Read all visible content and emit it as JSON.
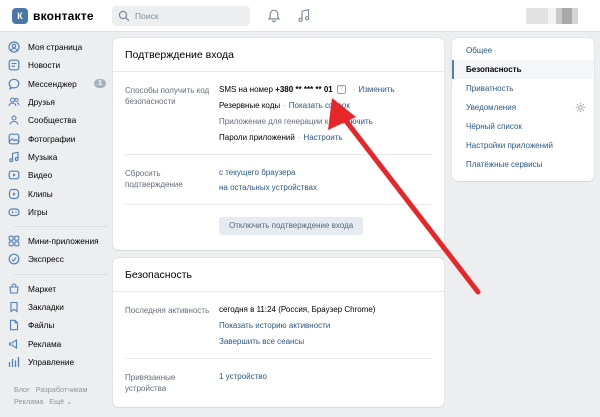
{
  "header": {
    "logo_text": "вконтакте",
    "logo_mark": "К",
    "search_placeholder": "Поиск",
    "bell_icon": "bell-icon",
    "music_icon": "music-icon"
  },
  "sidebar": {
    "items": [
      {
        "label": "Моя страница",
        "icon": "home-icon"
      },
      {
        "label": "Новости",
        "icon": "news-icon"
      },
      {
        "label": "Мессенджер",
        "icon": "message-icon",
        "badge": "1"
      },
      {
        "label": "Друзья",
        "icon": "friends-icon"
      },
      {
        "label": "Сообщества",
        "icon": "groups-icon"
      },
      {
        "label": "Фотографии",
        "icon": "photo-icon"
      },
      {
        "label": "Музыка",
        "icon": "music-icon"
      },
      {
        "label": "Видео",
        "icon": "video-icon"
      },
      {
        "label": "Клипы",
        "icon": "clips-icon"
      },
      {
        "label": "Игры",
        "icon": "games-icon"
      }
    ],
    "items2": [
      {
        "label": "Мини-приложения",
        "icon": "apps-icon"
      },
      {
        "label": "Экспресс",
        "icon": "express-icon"
      }
    ],
    "items3": [
      {
        "label": "Маркет",
        "icon": "market-icon"
      },
      {
        "label": "Закладки",
        "icon": "bookmark-icon"
      },
      {
        "label": "Файлы",
        "icon": "files-icon"
      },
      {
        "label": "Реклама",
        "icon": "ads-icon"
      },
      {
        "label": "Управление",
        "icon": "manage-icon"
      }
    ],
    "footer": {
      "blog": "Блог",
      "dev": "Разработчикам",
      "ads": "Реклама",
      "more": "Ещё ⌄"
    }
  },
  "login_confirm": {
    "title": "Подтверждение входа",
    "methods_label": "Способы получить код безопасности",
    "sms_prefix": "SMS на номер",
    "sms_number": "+380 ** *** ** 01",
    "help": "?",
    "change": "Изменить",
    "backup_codes": "Резервные коды",
    "show_list": "Показать список",
    "auth_app": "Приложение для генерации к",
    "enable": "Включить",
    "app_passwords": "Пароли приложений",
    "configure": "Настроить",
    "reset_label": "Сбросить подтверждение",
    "reset_current": "с текущего браузера",
    "reset_other": "на остальных устройствах",
    "disable_button": "Отключить подтверждение входа"
  },
  "security": {
    "title": "Безопасность",
    "last_activity_label": "Последняя активность",
    "last_activity_value": "сегодня в 11:24 (Россия, Браузер Chrome)",
    "show_history": "Показать историю активности",
    "end_sessions": "Завершить все сеансы",
    "linked_label": "Привязанные устройства",
    "linked_value": "1 устройство"
  },
  "settings_nav": {
    "items": [
      "Общее",
      "Безопасность",
      "Приватность",
      "Уведомления",
      "Чёрный список",
      "Настройки приложений",
      "Платёжные сервисы"
    ],
    "active": "Безопасность"
  },
  "colors": {
    "accent": "#4a76a8",
    "link": "#2a5885",
    "arrow": "#e8262a"
  }
}
